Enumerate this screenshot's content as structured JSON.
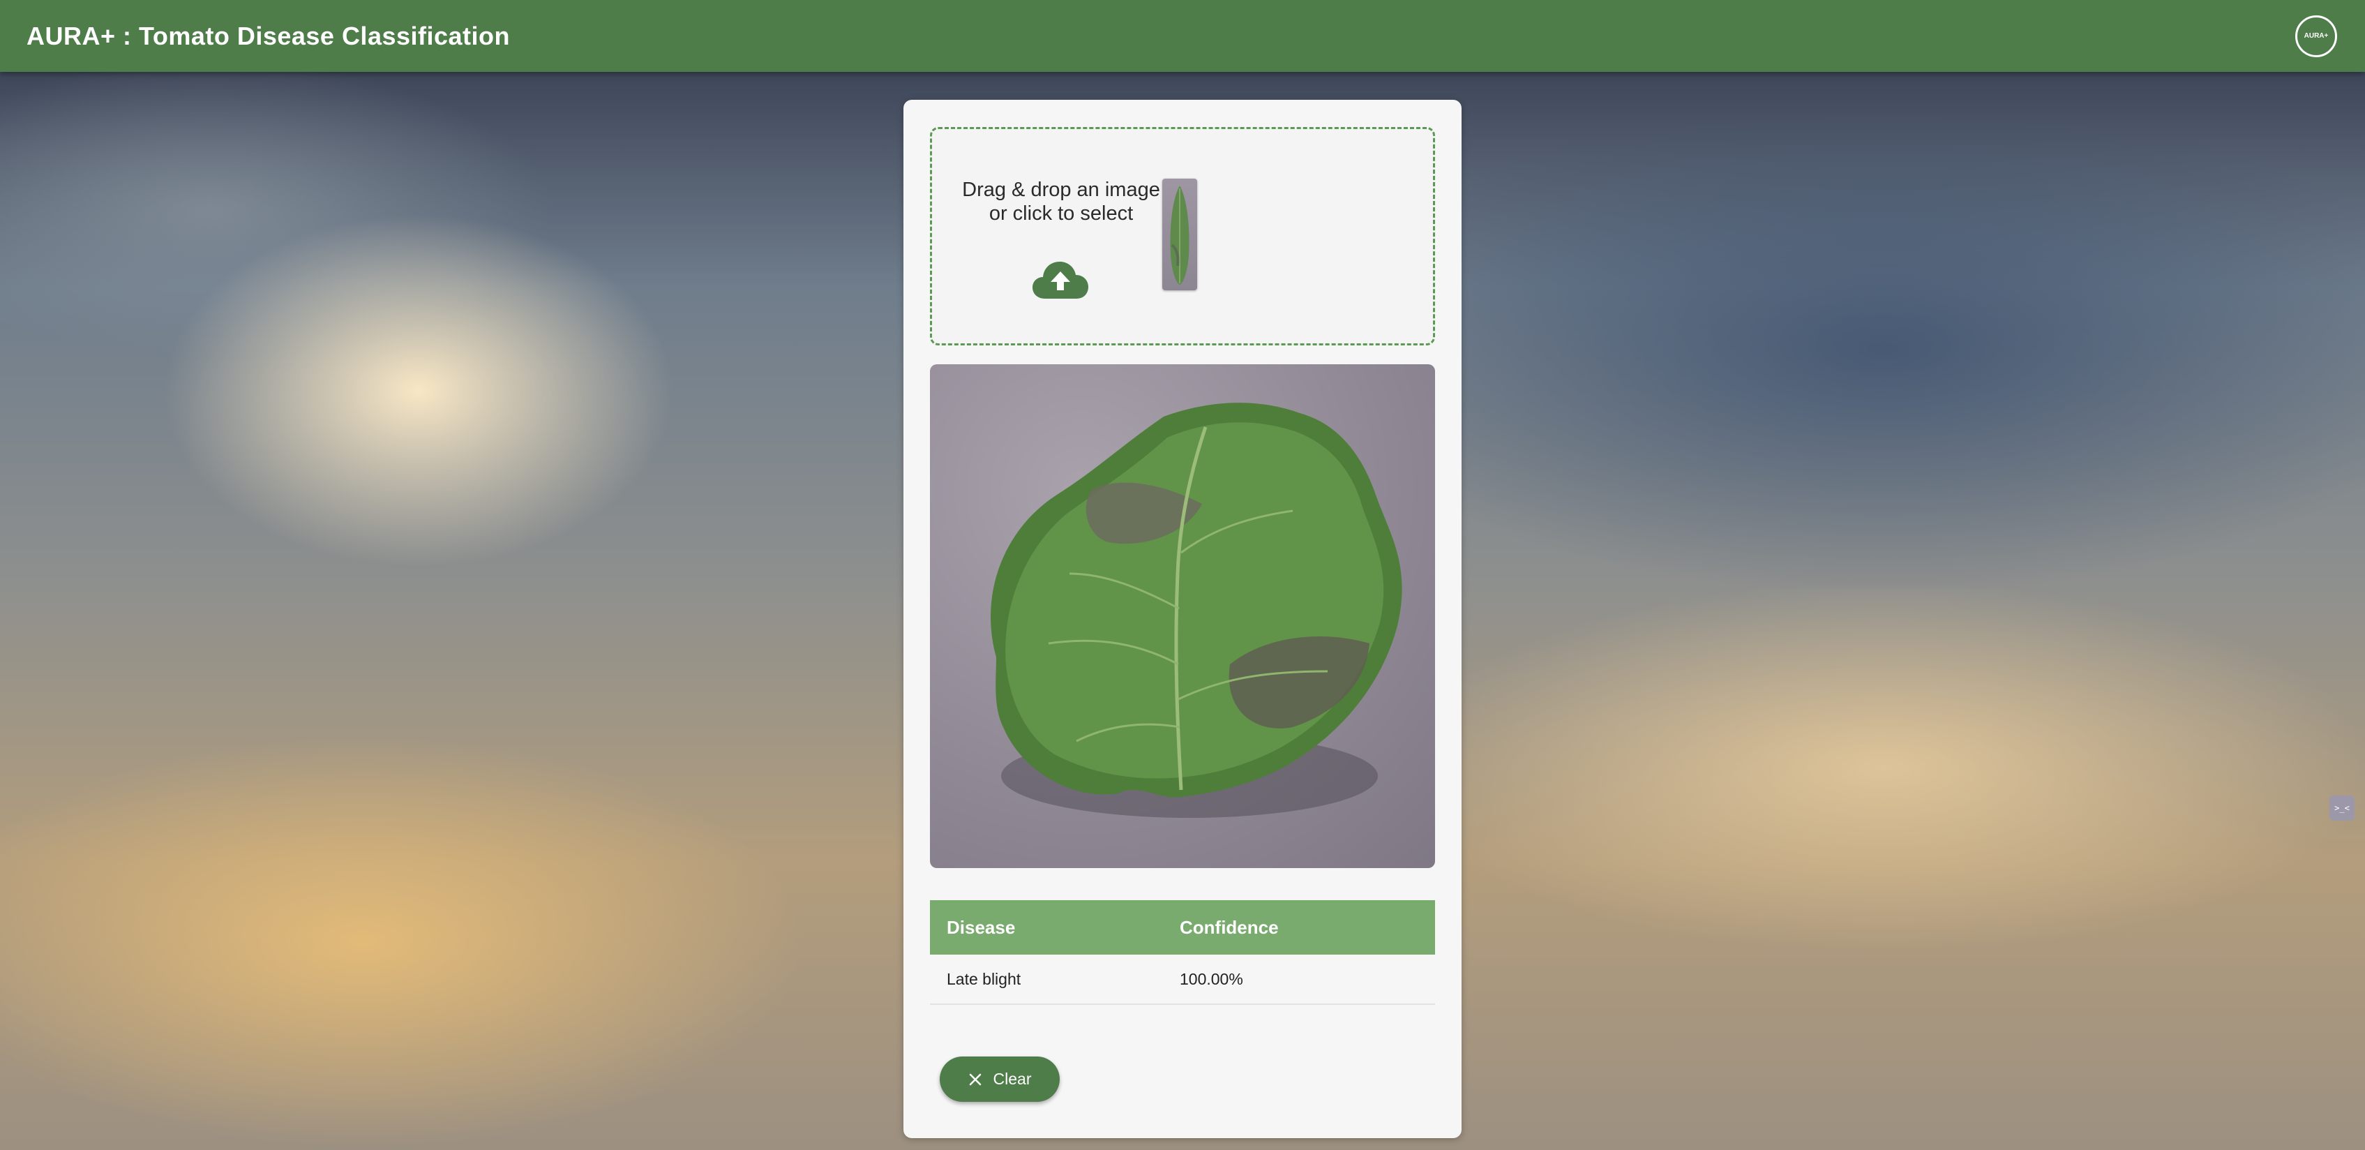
{
  "header": {
    "title": "AURA+ : Tomato Disease Classification",
    "logo_text": "AURA+"
  },
  "upload": {
    "prompt_line1": "Drag & drop an image",
    "prompt_line2": "or click to select"
  },
  "results": {
    "columns": [
      "Disease",
      "Confidence"
    ],
    "rows": [
      {
        "disease": "Late blight",
        "confidence": "100.00%"
      }
    ]
  },
  "actions": {
    "clear_label": "Clear"
  },
  "side_widget": {
    "label": ">_<"
  },
  "colors": {
    "brand_green": "#4e7d4a",
    "table_header": "#79ab6e",
    "dropzone_border": "#5a9a52"
  }
}
